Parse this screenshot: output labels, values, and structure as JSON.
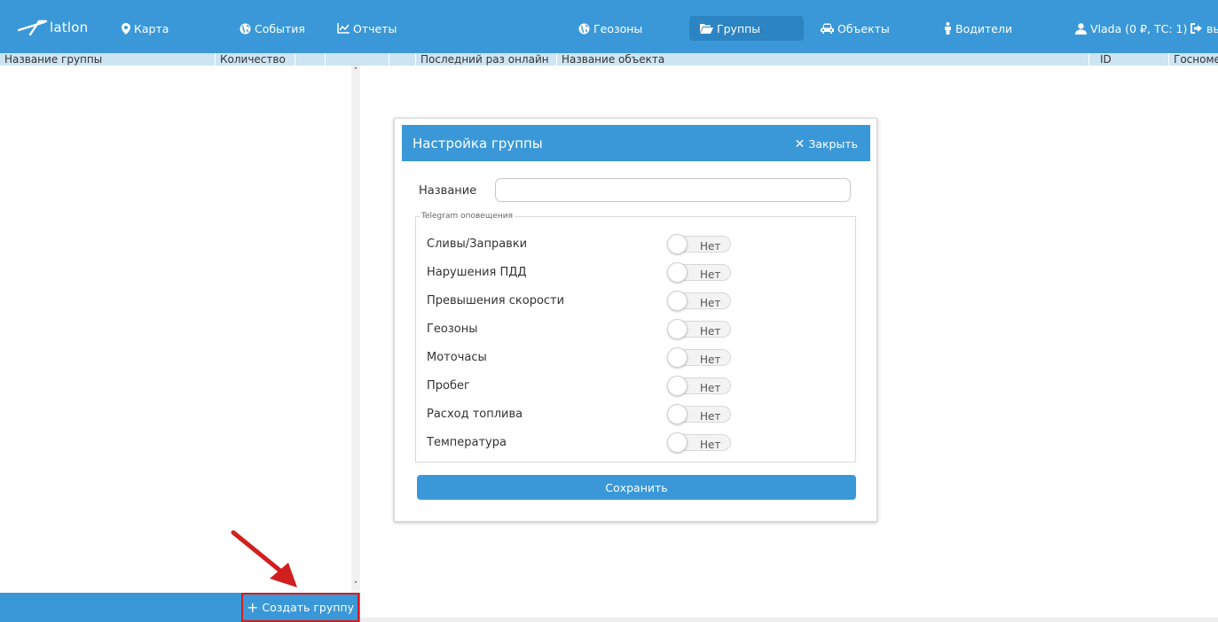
{
  "brand": {
    "logo_text": "latlon"
  },
  "nav": {
    "map": "Карта",
    "events": "События",
    "reports": "Отчеты",
    "geozones": "Геозоны",
    "groups": "Группы",
    "objects": "Объекты",
    "drivers": "Водители",
    "user": "Vlada (0 ₽, ТС: 1)",
    "logout": "вы"
  },
  "columns": {
    "group_name": "Название группы",
    "count": "Количество",
    "last_online": "Последний раз онлайн",
    "object_name": "Название объекта",
    "id": "ID",
    "plate": "Госномер"
  },
  "left_panel": {
    "create_group": "Создать группу",
    "scroll_up": "˄",
    "scroll_down": "˅"
  },
  "modal": {
    "title": "Настройка группы",
    "close": "Закрыть",
    "name_label": "Название",
    "name_value": "",
    "fieldset_legend": "Telegram оповещения",
    "toggles": [
      {
        "label": "Сливы/Заправки",
        "state": "Нет"
      },
      {
        "label": "Нарушения ПДД",
        "state": "Нет"
      },
      {
        "label": "Превышения скорости",
        "state": "Нет"
      },
      {
        "label": "Геозоны",
        "state": "Нет"
      },
      {
        "label": "Моточасы",
        "state": "Нет"
      },
      {
        "label": "Пробег",
        "state": "Нет"
      },
      {
        "label": "Расход топлива",
        "state": "Нет"
      },
      {
        "label": "Температура",
        "state": "Нет"
      }
    ],
    "save": "Сохранить"
  },
  "colors": {
    "primary": "#3a98d8",
    "primary_active": "#2c84c2",
    "header_strip": "#cde4f3",
    "highlight": "#d11f1f"
  }
}
